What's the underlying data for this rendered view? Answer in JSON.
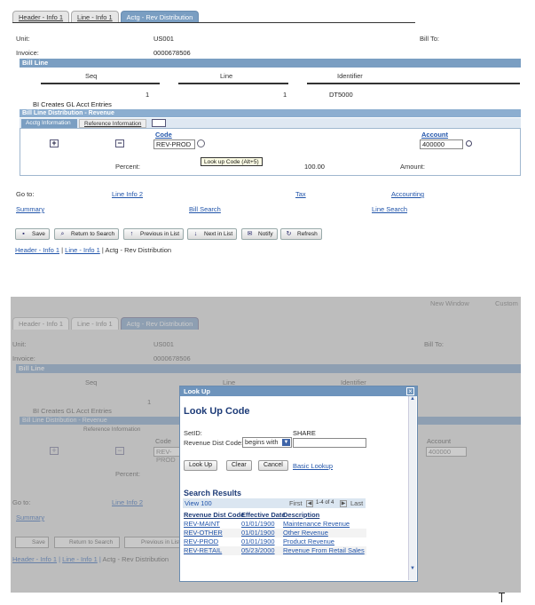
{
  "tabs": [
    "Header - Info 1",
    "Line - Info 1",
    "Actg - Rev Distribution"
  ],
  "unit": {
    "label": "Unit:",
    "value": "US001"
  },
  "bill_to": {
    "label": "Bill To:"
  },
  "invoice": {
    "label": "Invoice:",
    "value": "0000678506"
  },
  "bill_line": {
    "title": "Bill Line",
    "headers": [
      "Seq",
      "Line",
      "Identifier"
    ],
    "values": [
      "1",
      "1",
      "DT5000"
    ],
    "note": "BI Creates GL Acct Entries"
  },
  "distribution": {
    "title": "Bill Line Distribution - Revenue",
    "subtabs": [
      "Acctg Information",
      "Reference Information"
    ],
    "code_header": "Code",
    "account_header": "Account",
    "code_value": "REV-PROD",
    "account_value": "400000",
    "tooltip": "Look up Code (Alt+5)",
    "percent_label": "Percent:",
    "percent_value": "100.00",
    "amount_label": "Amount:"
  },
  "goto": {
    "label": "Go to:",
    "links": [
      "Line Info 2",
      "Tax",
      "Accounting",
      "Summary",
      "Bill Search",
      "Line Search"
    ]
  },
  "toolbar": [
    "Save",
    "Return to Search",
    "Previous in List",
    "Next in List",
    "Notify",
    "Refresh"
  ],
  "breadcrumb": [
    "Header - Info 1",
    "Line - Info 1",
    "Actg - Rev Distribution"
  ],
  "top_right": [
    "New Window",
    "Custom"
  ],
  "lookup": {
    "window_title": "Look Up",
    "heading": "Look Up Code",
    "setid_label": "SetID:",
    "setid_value": "SHARE",
    "field_label": "Revenue Dist Code:",
    "operator": "begins with",
    "buttons": [
      "Look Up",
      "Clear",
      "Cancel"
    ],
    "basic_lookup": "Basic Lookup",
    "results_title": "Search Results",
    "view": "View 100",
    "first": "First",
    "range": "1-4 of 4",
    "last": "Last",
    "columns": [
      "Revenue Dist Code",
      "Effective Date",
      "Description"
    ],
    "rows": [
      [
        "REV-MAINT",
        "01/01/1900",
        "Maintenance Revenue"
      ],
      [
        "REV-OTHER",
        "01/01/1900",
        "Other Revenue"
      ],
      [
        "REV-PROD",
        "01/01/1900",
        "Product Revenue"
      ],
      [
        "REV-RETAIL",
        "05/23/2000",
        "Revenue From Retail Sales"
      ]
    ]
  }
}
